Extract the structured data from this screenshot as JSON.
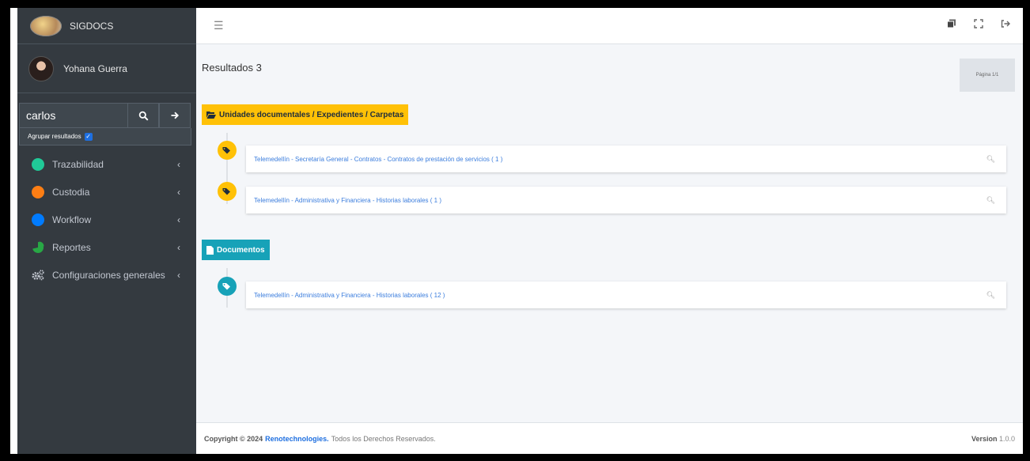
{
  "brand": {
    "name": "SIGDOCS"
  },
  "user": {
    "name": "Yohana Guerra"
  },
  "search": {
    "value": "carlos",
    "grouping_label": "Agrupar resultados",
    "grouping_checked": true
  },
  "nav": [
    {
      "label": "Trazabilidad",
      "color": "#20c997"
    },
    {
      "label": "Custodia",
      "color": "#fd7e14"
    },
    {
      "label": "Workflow",
      "color": "#007bff"
    },
    {
      "label": "Reportes",
      "color": "#28a745"
    },
    {
      "label": "Configuraciones generales",
      "color": "#c2c7d0"
    }
  ],
  "main": {
    "results_title": "Resultados 3",
    "page_indicator": "Página 1/1",
    "sections": [
      {
        "label": "Unidades documentales / Expedientes / Carpetas",
        "items": [
          {
            "text": "Telemedellín - Secretaría General - Contratos - Contratos de prestación de servicios ( 1 )"
          },
          {
            "text": "Telemedellín - Administrativa y Financiera - Historias laborales ( 1 )"
          }
        ]
      },
      {
        "label": "Documentos",
        "items": [
          {
            "text": "Telemedellín - Administrativa y Financiera - Historias laborales ( 12 )"
          }
        ]
      }
    ]
  },
  "footer": {
    "copyright": "Copyright © 2024",
    "company": "Renotechnologies.",
    "rights": "Todos los Derechos Reservados.",
    "version_label": "Version",
    "version": "1.0.0"
  }
}
